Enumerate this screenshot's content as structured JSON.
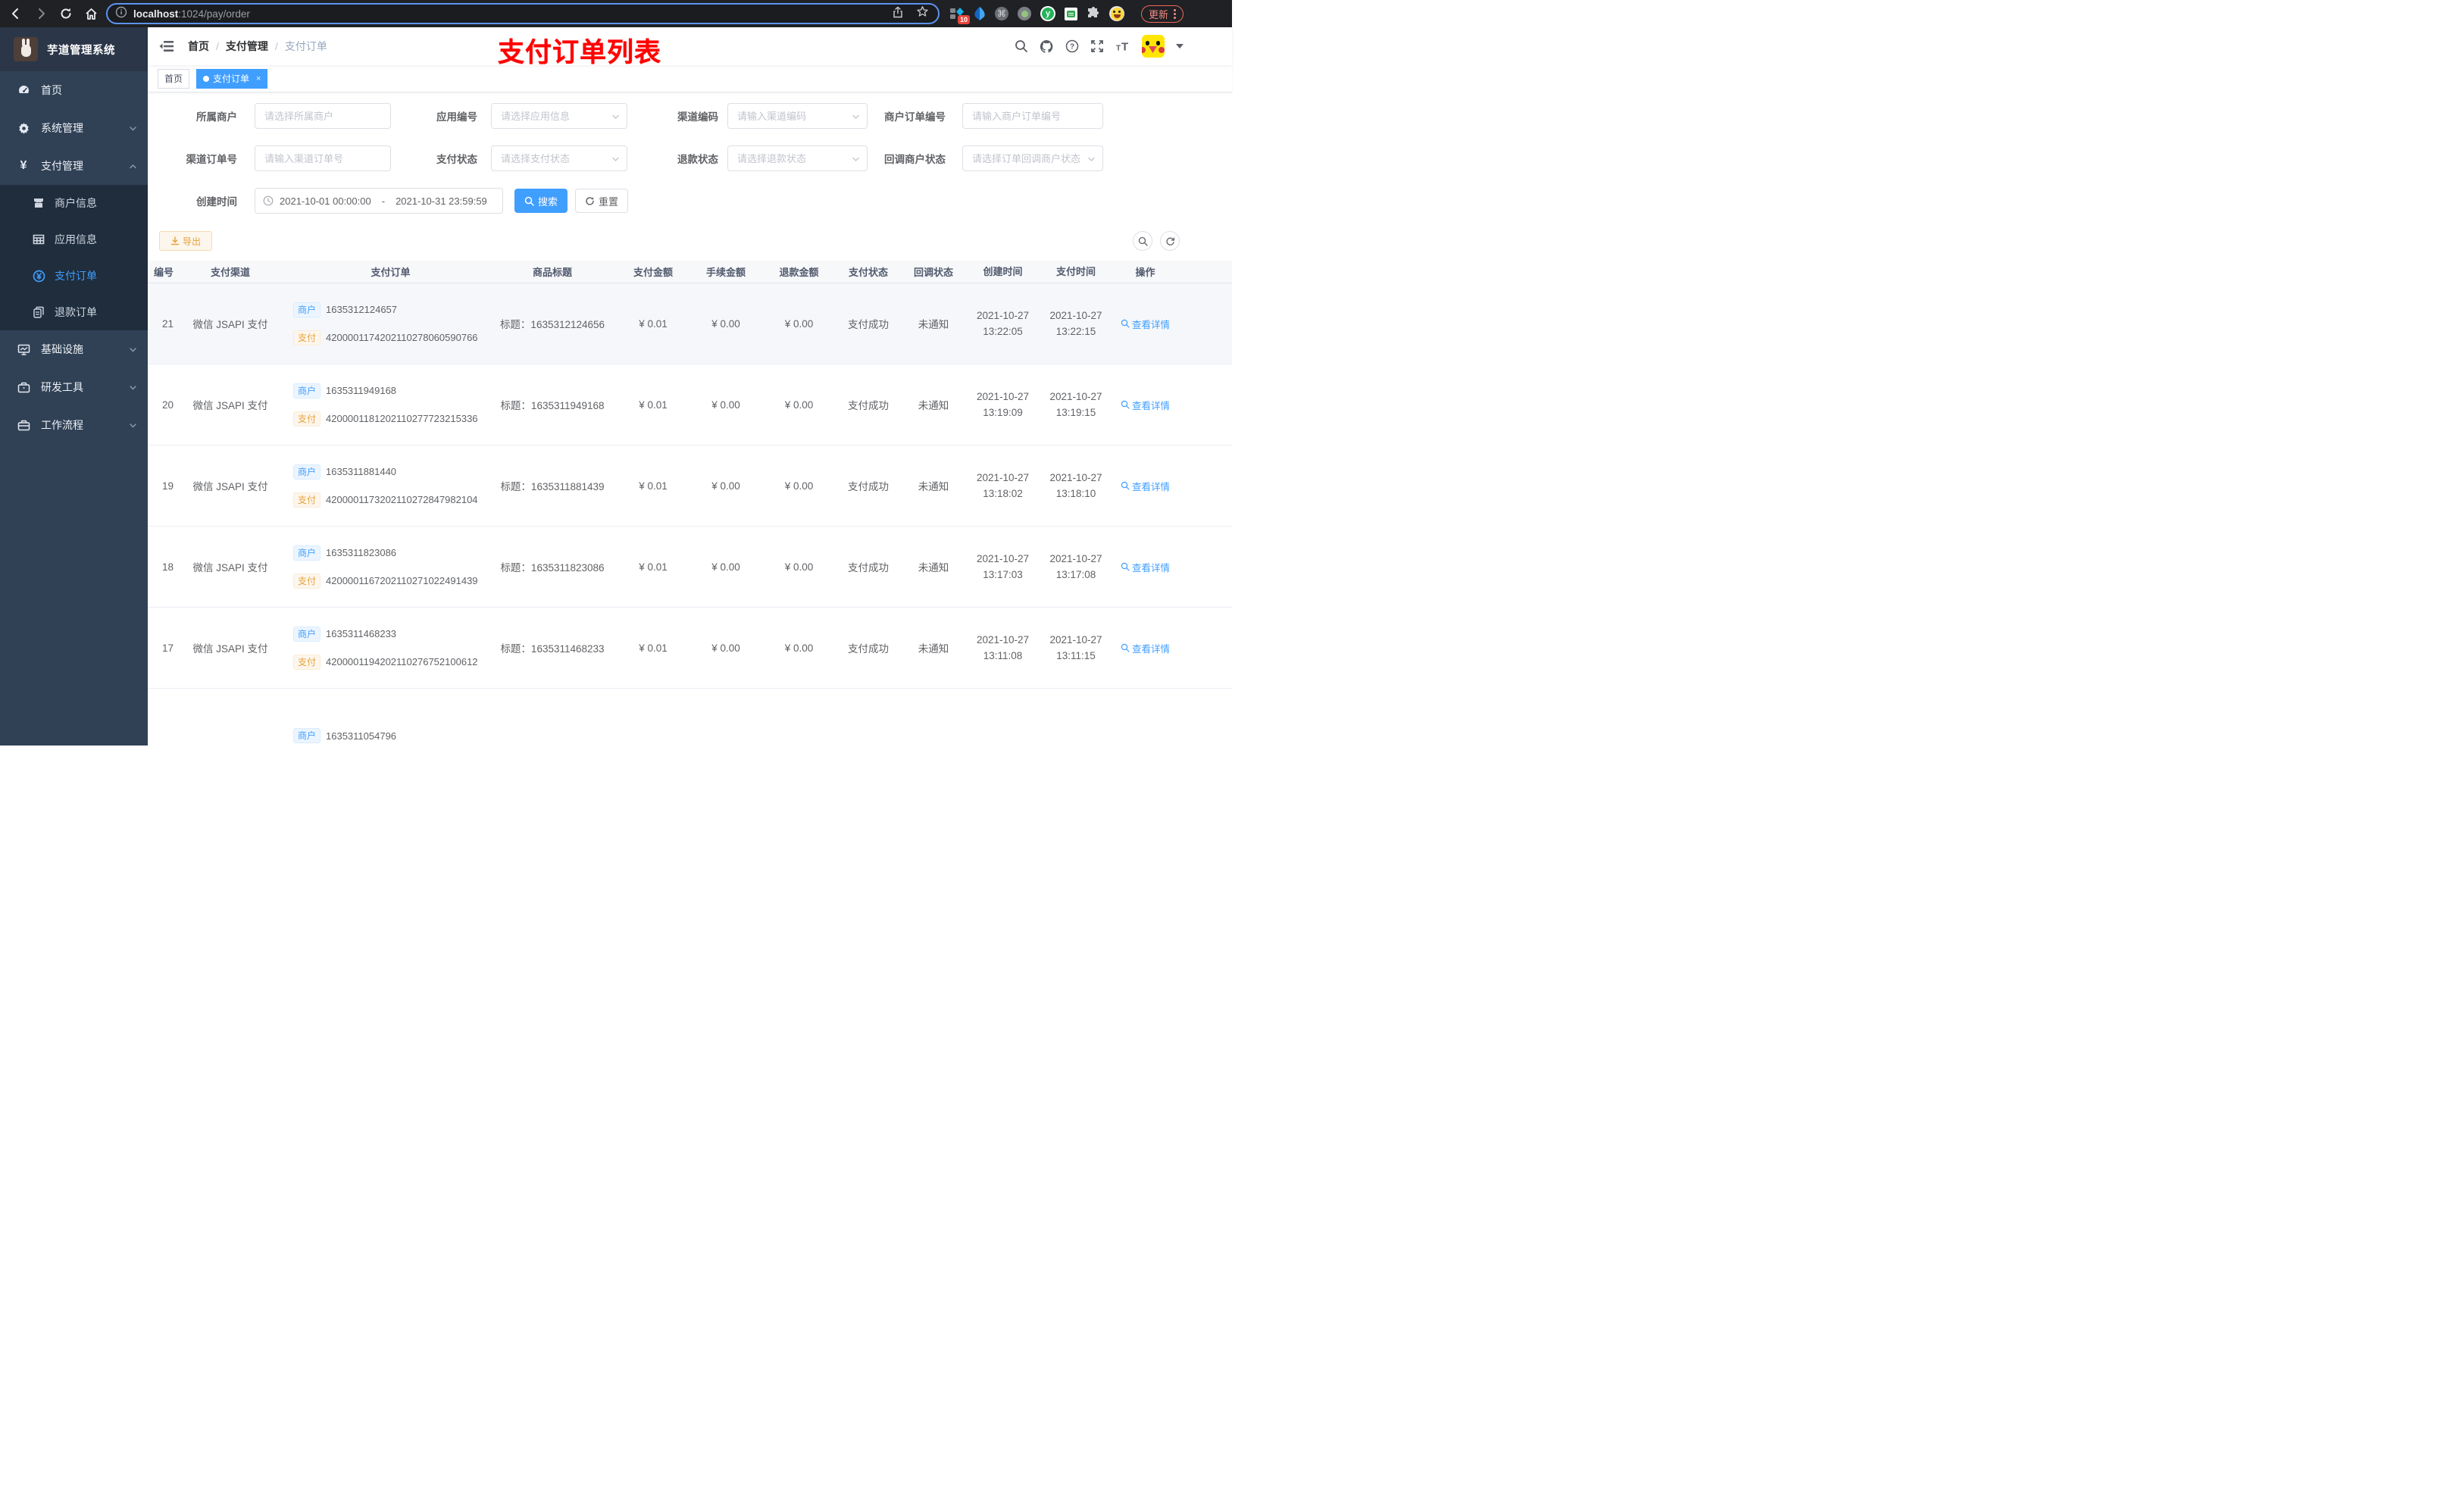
{
  "colors": {
    "primary": "#409eff",
    "sidebar_bg": "#304156",
    "submenu_bg": "#1f2d3d",
    "tag_merchant_text": "#409eff",
    "tag_pay_text": "#e6a23c",
    "annotation_red": "#ff0000",
    "active_tag_bg": "#409eff"
  },
  "browser": {
    "url_host": "localhost",
    "url_path": ":1024/pay/order",
    "ext_badge_count": "10",
    "update_label": "更新"
  },
  "sidebar": {
    "title": "芋道管理系统",
    "items": [
      {
        "label": "首页",
        "icon": "dashboard-icon"
      },
      {
        "label": "系统管理",
        "icon": "gear-icon"
      },
      {
        "label": "支付管理",
        "icon": "yen-icon"
      },
      {
        "label": "商户信息",
        "icon": "shop-icon"
      },
      {
        "label": "应用信息",
        "icon": "grid-icon"
      },
      {
        "label": "支付订单",
        "icon": "pay-order-icon"
      },
      {
        "label": "退款订单",
        "icon": "refund-icon"
      },
      {
        "label": "基础设施",
        "icon": "infra-icon"
      },
      {
        "label": "研发工具",
        "icon": "tools-icon"
      },
      {
        "label": "工作流程",
        "icon": "workflow-icon"
      }
    ]
  },
  "navbar": {
    "breadcrumb": {
      "home": "首页",
      "parent": "支付管理",
      "current": "支付订单",
      "separator": "/"
    },
    "annotation": "支付订单列表"
  },
  "tags": {
    "home": "首页",
    "active": "支付订单",
    "close": "×"
  },
  "filters": {
    "fields": [
      {
        "label": "所属商户",
        "placeholder": "请选择所属商户"
      },
      {
        "label": "应用编号",
        "placeholder": "请选择应用信息"
      },
      {
        "label": "渠道编码",
        "placeholder": "请输入渠道编码"
      },
      {
        "label": "商户订单编号",
        "placeholder": "请输入商户订单编号"
      },
      {
        "label": "渠道订单号",
        "placeholder": "请输入渠道订单号"
      },
      {
        "label": "支付状态",
        "placeholder": "请选择支付状态"
      },
      {
        "label": "退款状态",
        "placeholder": "请选择退款状态"
      },
      {
        "label": "回调商户状态",
        "placeholder": "请选择订单回调商户状态"
      }
    ],
    "date": {
      "label": "创建时间",
      "start": "2021-10-01 00:00:00",
      "separator": "-",
      "end": "2021-10-31 23:59:59"
    },
    "search_label": "搜索",
    "reset_label": "重置",
    "export_label": "导出"
  },
  "table": {
    "headers": [
      "编号",
      "支付渠道",
      "支付订单",
      "商品标题",
      "支付金额",
      "手续金额",
      "退款金额",
      "支付状态",
      "回调状态",
      "创建时间",
      "支付时间",
      "操作"
    ],
    "tag_merchant": "商户",
    "tag_pay": "支付",
    "rows": [
      {
        "id": "21",
        "channel": "微信 JSAPI 支付",
        "merchant_no": "1635312124657",
        "pay_no": "4200001174202110278060590766",
        "title": "标题：1635312124656",
        "amount": "¥ 0.01",
        "fee": "¥ 0.00",
        "refund": "¥ 0.00",
        "status": "支付成功",
        "notify": "未通知",
        "ctime_d": "2021-10-27",
        "ctime_t": "13:22:05",
        "ptime_d": "2021-10-27",
        "ptime_t": "13:22:15",
        "action": "查看详情"
      },
      {
        "id": "20",
        "channel": "微信 JSAPI 支付",
        "merchant_no": "1635311949168",
        "pay_no": "4200001181202110277723215336",
        "title": "标题：1635311949168",
        "amount": "¥ 0.01",
        "fee": "¥ 0.00",
        "refund": "¥ 0.00",
        "status": "支付成功",
        "notify": "未通知",
        "ctime_d": "2021-10-27",
        "ctime_t": "13:19:09",
        "ptime_d": "2021-10-27",
        "ptime_t": "13:19:15",
        "action": "查看详情"
      },
      {
        "id": "19",
        "channel": "微信 JSAPI 支付",
        "merchant_no": "1635311881440",
        "pay_no": "4200001173202110272847982104",
        "title": "标题：1635311881439",
        "amount": "¥ 0.01",
        "fee": "¥ 0.00",
        "refund": "¥ 0.00",
        "status": "支付成功",
        "notify": "未通知",
        "ctime_d": "2021-10-27",
        "ctime_t": "13:18:02",
        "ptime_d": "2021-10-27",
        "ptime_t": "13:18:10",
        "action": "查看详情"
      },
      {
        "id": "18",
        "channel": "微信 JSAPI 支付",
        "merchant_no": "1635311823086",
        "pay_no": "4200001167202110271022491439",
        "title": "标题：1635311823086",
        "amount": "¥ 0.01",
        "fee": "¥ 0.00",
        "refund": "¥ 0.00",
        "status": "支付成功",
        "notify": "未通知",
        "ctime_d": "2021-10-27",
        "ctime_t": "13:17:03",
        "ptime_d": "2021-10-27",
        "ptime_t": "13:17:08",
        "action": "查看详情"
      },
      {
        "id": "17",
        "channel": "微信 JSAPI 支付",
        "merchant_no": "1635311468233",
        "pay_no": "4200001194202110276752100612",
        "title": "标题：1635311468233",
        "amount": "¥ 0.01",
        "fee": "¥ 0.00",
        "refund": "¥ 0.00",
        "status": "支付成功",
        "notify": "未通知",
        "ctime_d": "2021-10-27",
        "ctime_t": "13:11:08",
        "ptime_d": "2021-10-27",
        "ptime_t": "13:11:15",
        "action": "查看详情"
      }
    ],
    "partial_row": {
      "merchant_no": "1635311054796"
    }
  }
}
